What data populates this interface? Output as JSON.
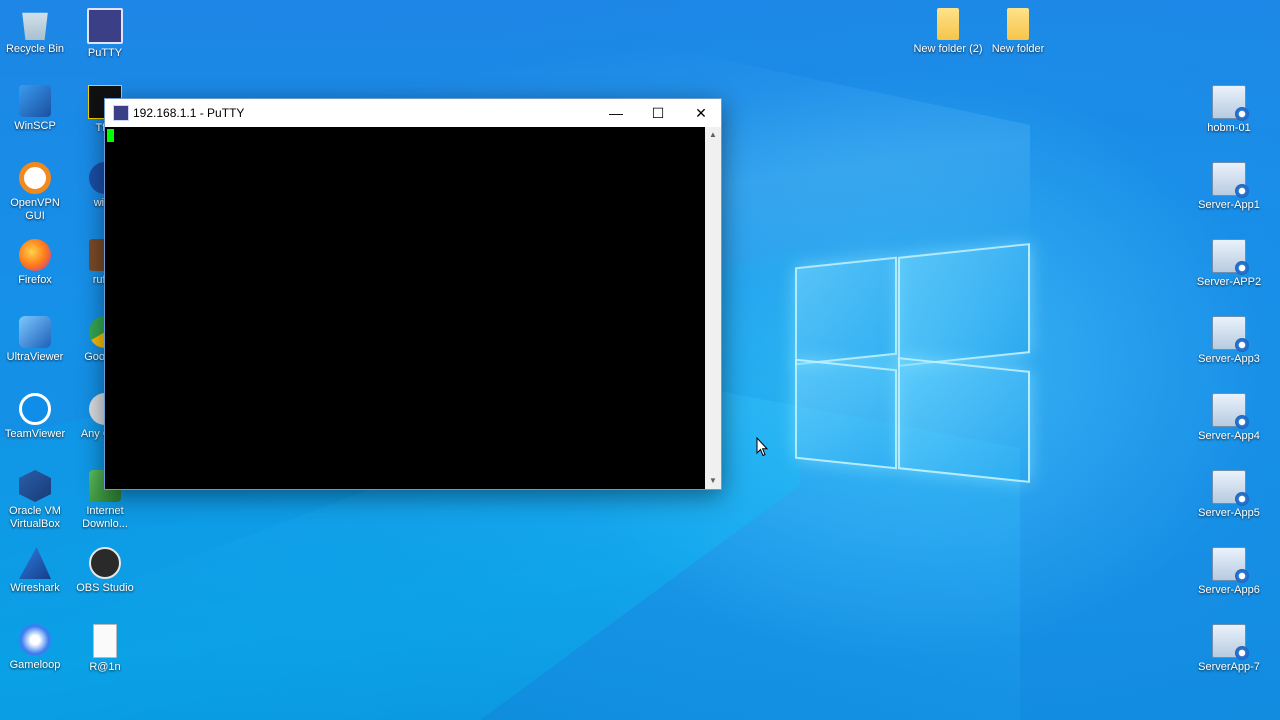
{
  "desktop": {
    "left_column_1": [
      {
        "label": "Recycle Bin",
        "icon": "recycle-bin-icon"
      },
      {
        "label": "WinSCP",
        "icon": "winscp-icon"
      },
      {
        "label": "OpenVPN GUI",
        "icon": "openvpn-icon"
      },
      {
        "label": "Firefox",
        "icon": "firefox-icon"
      },
      {
        "label": "UltraViewer",
        "icon": "ultraviewer-icon"
      },
      {
        "label": "TeamViewer",
        "icon": "teamviewer-icon"
      },
      {
        "label": "Oracle VM VirtualBox",
        "icon": "virtualbox-icon"
      },
      {
        "label": "Wireshark",
        "icon": "wireshark-icon"
      },
      {
        "label": "Gameloop",
        "icon": "gameloop-icon"
      }
    ],
    "left_column_2": [
      {
        "label": "PuTTY",
        "icon": "putty-icon"
      },
      {
        "label": "Tftp",
        "icon": "tftp-icon"
      },
      {
        "label": "winb",
        "icon": "winbox-icon"
      },
      {
        "label": "rufus",
        "icon": "rufus-icon"
      },
      {
        "label": "Goo Chr",
        "icon": "chrome-icon"
      },
      {
        "label": "Any Conn",
        "icon": "anyconnect-icon"
      },
      {
        "label": "Internet Downlo...",
        "icon": "idm-icon"
      },
      {
        "label": "OBS Studio",
        "icon": "obs-icon"
      },
      {
        "label": "R@1n",
        "icon": "text-file-icon"
      }
    ],
    "top_folders": [
      {
        "label": "New folder (2)",
        "icon": "folder-icon"
      },
      {
        "label": "New folder",
        "icon": "folder-icon"
      }
    ],
    "right_column": [
      {
        "label": "hobm-01",
        "icon": "rdp-icon"
      },
      {
        "label": "Server-App1",
        "icon": "rdp-icon"
      },
      {
        "label": "Server-APP2",
        "icon": "rdp-icon"
      },
      {
        "label": "Server-App3",
        "icon": "rdp-icon"
      },
      {
        "label": "Server-App4",
        "icon": "rdp-icon"
      },
      {
        "label": "Server-App5",
        "icon": "rdp-icon"
      },
      {
        "label": "Server-App6",
        "icon": "rdp-icon"
      },
      {
        "label": "ServerApp-7",
        "icon": "rdp-icon"
      }
    ]
  },
  "putty_window": {
    "title": "192.168.1.1 - PuTTY",
    "minimize_glyph": "—",
    "maximize_glyph": "☐",
    "close_glyph": "✕",
    "terminal_bg": "#000000",
    "cursor_color": "#00ff00"
  },
  "colors": {
    "desktop_accent": "#1591e8"
  }
}
